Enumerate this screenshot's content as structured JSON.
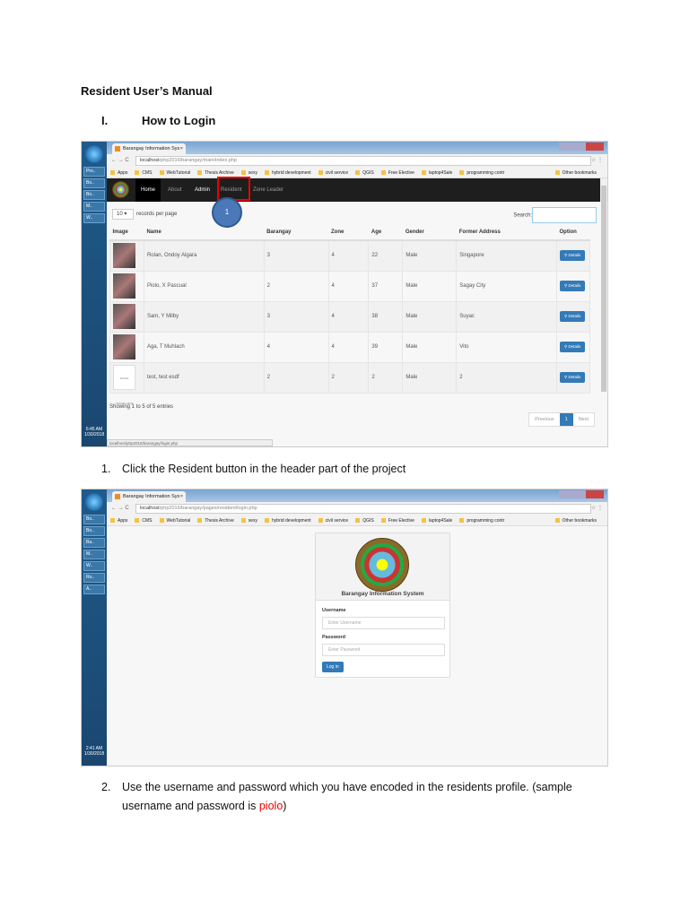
{
  "doc": {
    "title": "Resident User’s Manual",
    "section_num": "I.",
    "section_title": "How to Login",
    "step1_num": "1.",
    "step1_text": "Click the Resident button in the header part of the project",
    "step2_num": "2.",
    "step2_text_a": "Use the username and password which you have encoded in the residents profile. (sample username and password is ",
    "step2_highlight": "piolo",
    "step2_text_b": ")"
  },
  "taskbar1": {
    "items": [
      "Pro..",
      "Bo..",
      "Bo..",
      "M..",
      "W.."
    ],
    "clock_time": "6:45 AM",
    "clock_date": "1/30/2018"
  },
  "taskbar2": {
    "items": [
      "Bo..",
      "Bo..",
      "Ba..",
      "M..",
      "W..",
      "Ro..",
      "A.."
    ],
    "clock_time": "2:41 AM",
    "clock_date": "1/30/2018"
  },
  "browser": {
    "tab_title": "Barangay Information Sys",
    "tab_close": "×",
    "url1_host": "localhost",
    "url1_path": "/php2016/barangay/main/index.php",
    "url2_host": "localhost",
    "url2_path": "/php2016/barangay/pages/resident/login.php",
    "bookmarks": [
      "Apps",
      "CMS",
      "WebTutorial",
      "Thesis Archive",
      "sexy",
      "hybrid development",
      "civil service",
      "QGIS",
      "Free Elective",
      "laptop4Sale",
      "programming contr"
    ],
    "other_bookmarks": "Other bookmarks",
    "status_url": "localhost/php2016/barangay/login.php"
  },
  "navbar": {
    "items": [
      "Home",
      "About",
      "Admin",
      "Resident",
      "Zone Leader"
    ]
  },
  "annotation": {
    "marker": "1"
  },
  "table_page": {
    "records_value": "10",
    "records_label": "records per page",
    "search_label": "Search:",
    "columns": [
      "Image",
      "Name",
      "Barangay",
      "Zone",
      "Age",
      "Gender",
      "Former Address",
      "Option"
    ],
    "rows": [
      {
        "name": "Rolan, Ondoy Algara",
        "barangay": "3",
        "zone": "4",
        "age": "22",
        "gender": "Male",
        "address": "Singapore"
      },
      {
        "name": "Piolo, X Pascual",
        "barangay": "2",
        "zone": "4",
        "age": "37",
        "gender": "Male",
        "address": "Sagay City"
      },
      {
        "name": "Sam, Y Milby",
        "barangay": "3",
        "zone": "4",
        "age": "38",
        "gender": "Male",
        "address": "Suyac"
      },
      {
        "name": "Aga, T Muhlach",
        "barangay": "4",
        "zone": "4",
        "age": "39",
        "gender": "Male",
        "address": "Vito"
      },
      {
        "name": "test, test esdf",
        "barangay": "2",
        "zone": "2",
        "age": "2",
        "gender": "Male",
        "address": "2"
      }
    ],
    "details_label": "Details",
    "no_image_text": "IMAGE UNAVAILABLE",
    "showing": "Showing 1 to 5 of 5 entries",
    "pager": {
      "prev": "Previous",
      "current": "1",
      "next": "Next"
    }
  },
  "login": {
    "title": "Barangay Information System",
    "username_label": "Username",
    "username_placeholder": "Enter Username",
    "password_label": "Password",
    "password_placeholder": "Enter Password",
    "login_button": "Log in"
  }
}
